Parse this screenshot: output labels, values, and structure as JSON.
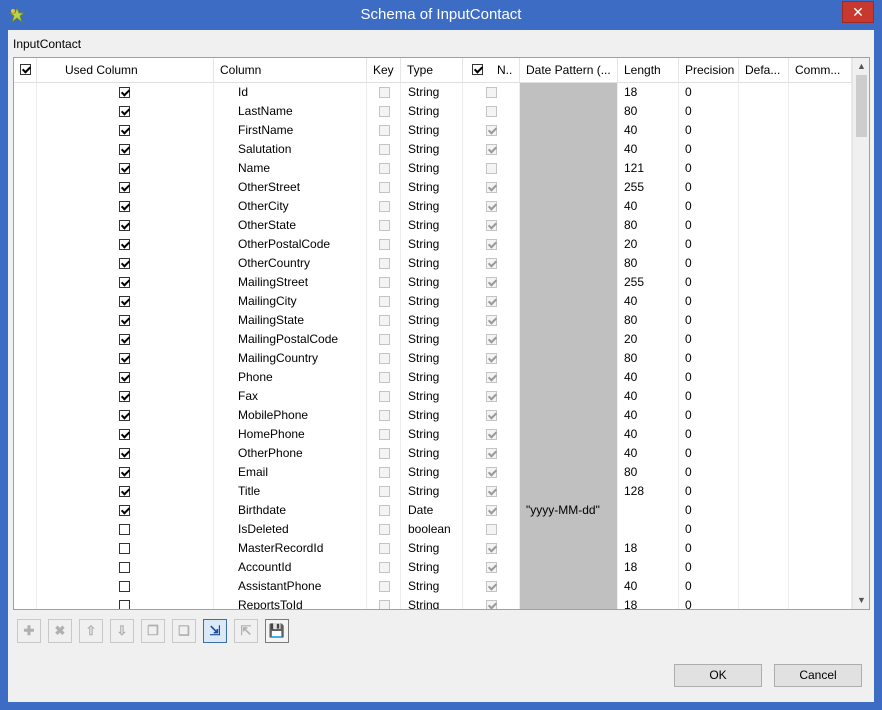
{
  "window": {
    "title": "Schema of InputContact",
    "close_glyph": "✕",
    "icon": "talend-star-icon"
  },
  "group_label": "InputContact",
  "table": {
    "headers": {
      "used": "Used Column",
      "column": "Column",
      "key": "Key",
      "type": "Type",
      "nullable": "N..",
      "date_pattern": "Date Pattern (...",
      "length": "Length",
      "precision": "Precision",
      "default": "Defa...",
      "comment": "Comm..."
    },
    "header_used_checked": true,
    "header_nullable_checked": true,
    "rows": [
      {
        "used": true,
        "name": "Id",
        "key": false,
        "type": "String",
        "nullable": false,
        "date_pattern": "",
        "length": "18",
        "precision": "0"
      },
      {
        "used": true,
        "name": "LastName",
        "key": false,
        "type": "String",
        "nullable": false,
        "date_pattern": "",
        "length": "80",
        "precision": "0"
      },
      {
        "used": true,
        "name": "FirstName",
        "key": false,
        "type": "String",
        "nullable": true,
        "date_pattern": "",
        "length": "40",
        "precision": "0"
      },
      {
        "used": true,
        "name": "Salutation",
        "key": false,
        "type": "String",
        "nullable": true,
        "date_pattern": "",
        "length": "40",
        "precision": "0"
      },
      {
        "used": true,
        "name": "Name",
        "key": false,
        "type": "String",
        "nullable": false,
        "date_pattern": "",
        "length": "121",
        "precision": "0"
      },
      {
        "used": true,
        "name": "OtherStreet",
        "key": false,
        "type": "String",
        "nullable": true,
        "date_pattern": "",
        "length": "255",
        "precision": "0"
      },
      {
        "used": true,
        "name": "OtherCity",
        "key": false,
        "type": "String",
        "nullable": true,
        "date_pattern": "",
        "length": "40",
        "precision": "0"
      },
      {
        "used": true,
        "name": "OtherState",
        "key": false,
        "type": "String",
        "nullable": true,
        "date_pattern": "",
        "length": "80",
        "precision": "0"
      },
      {
        "used": true,
        "name": "OtherPostalCode",
        "key": false,
        "type": "String",
        "nullable": true,
        "date_pattern": "",
        "length": "20",
        "precision": "0"
      },
      {
        "used": true,
        "name": "OtherCountry",
        "key": false,
        "type": "String",
        "nullable": true,
        "date_pattern": "",
        "length": "80",
        "precision": "0"
      },
      {
        "used": true,
        "name": "MailingStreet",
        "key": false,
        "type": "String",
        "nullable": true,
        "date_pattern": "",
        "length": "255",
        "precision": "0"
      },
      {
        "used": true,
        "name": "MailingCity",
        "key": false,
        "type": "String",
        "nullable": true,
        "date_pattern": "",
        "length": "40",
        "precision": "0"
      },
      {
        "used": true,
        "name": "MailingState",
        "key": false,
        "type": "String",
        "nullable": true,
        "date_pattern": "",
        "length": "80",
        "precision": "0"
      },
      {
        "used": true,
        "name": "MailingPostalCode",
        "key": false,
        "type": "String",
        "nullable": true,
        "date_pattern": "",
        "length": "20",
        "precision": "0"
      },
      {
        "used": true,
        "name": "MailingCountry",
        "key": false,
        "type": "String",
        "nullable": true,
        "date_pattern": "",
        "length": "80",
        "precision": "0"
      },
      {
        "used": true,
        "name": "Phone",
        "key": false,
        "type": "String",
        "nullable": true,
        "date_pattern": "",
        "length": "40",
        "precision": "0"
      },
      {
        "used": true,
        "name": "Fax",
        "key": false,
        "type": "String",
        "nullable": true,
        "date_pattern": "",
        "length": "40",
        "precision": "0"
      },
      {
        "used": true,
        "name": "MobilePhone",
        "key": false,
        "type": "String",
        "nullable": true,
        "date_pattern": "",
        "length": "40",
        "precision": "0"
      },
      {
        "used": true,
        "name": "HomePhone",
        "key": false,
        "type": "String",
        "nullable": true,
        "date_pattern": "",
        "length": "40",
        "precision": "0"
      },
      {
        "used": true,
        "name": "OtherPhone",
        "key": false,
        "type": "String",
        "nullable": true,
        "date_pattern": "",
        "length": "40",
        "precision": "0"
      },
      {
        "used": true,
        "name": "Email",
        "key": false,
        "type": "String",
        "nullable": true,
        "date_pattern": "",
        "length": "80",
        "precision": "0"
      },
      {
        "used": true,
        "name": "Title",
        "key": false,
        "type": "String",
        "nullable": true,
        "date_pattern": "",
        "length": "128",
        "precision": "0"
      },
      {
        "used": true,
        "name": "Birthdate",
        "key": false,
        "type": "Date",
        "nullable": true,
        "date_pattern": "\"yyyy-MM-dd\"",
        "length": "",
        "precision": "0"
      },
      {
        "used": false,
        "name": "IsDeleted",
        "key": false,
        "type": "boolean",
        "nullable": false,
        "date_pattern": "",
        "length": "",
        "precision": "0"
      },
      {
        "used": false,
        "name": "MasterRecordId",
        "key": false,
        "type": "String",
        "nullable": true,
        "date_pattern": "",
        "length": "18",
        "precision": "0"
      },
      {
        "used": false,
        "name": "AccountId",
        "key": false,
        "type": "String",
        "nullable": true,
        "date_pattern": "",
        "length": "18",
        "precision": "0"
      },
      {
        "used": false,
        "name": "AssistantPhone",
        "key": false,
        "type": "String",
        "nullable": true,
        "date_pattern": "",
        "length": "40",
        "precision": "0"
      },
      {
        "used": false,
        "name": "ReportsToId",
        "key": false,
        "type": "String",
        "nullable": true,
        "date_pattern": "",
        "length": "18",
        "precision": "0"
      }
    ]
  },
  "toolbar": {
    "buttons": [
      {
        "name": "add-row-button",
        "glyph": "✚",
        "state": "disabled"
      },
      {
        "name": "remove-row-button",
        "glyph": "✖",
        "state": "disabled"
      },
      {
        "name": "move-up-button",
        "glyph": "⇧",
        "state": "disabled"
      },
      {
        "name": "move-down-button",
        "glyph": "⇩",
        "state": "disabled"
      },
      {
        "name": "copy-button",
        "glyph": "❐",
        "state": "disabled"
      },
      {
        "name": "paste-button",
        "glyph": "❏",
        "state": "disabled"
      },
      {
        "name": "import-schema-button",
        "glyph": "⇲",
        "state": "selected"
      },
      {
        "name": "export-schema-button",
        "glyph": "⇱",
        "state": "disabled"
      },
      {
        "name": "save-schema-button",
        "glyph": "💾",
        "state": "active"
      }
    ]
  },
  "buttons": {
    "ok": "OK",
    "cancel": "Cancel"
  },
  "colors": {
    "titlebar": "#3c6cc4",
    "close": "#c7392f",
    "date_pattern_cell": "#c0c0c0"
  }
}
